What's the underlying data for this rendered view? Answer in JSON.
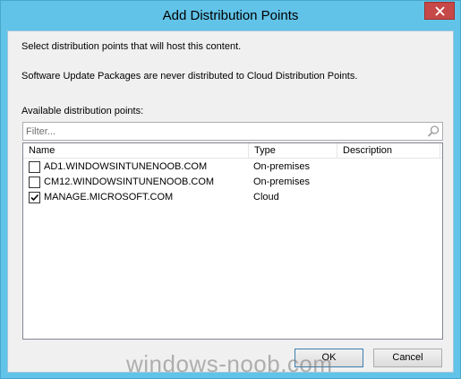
{
  "window": {
    "title": "Add Distribution Points"
  },
  "body": {
    "instruction": "Select distribution points that will host this content.",
    "note": "Software Update Packages are never distributed to Cloud Distribution Points.",
    "available_label": "Available distribution points:"
  },
  "filter": {
    "placeholder": "Filter..."
  },
  "list": {
    "columns": [
      "Name",
      "Type",
      "Description"
    ],
    "rows": [
      {
        "name": "AD1.WINDOWSINTUNENOOB.COM",
        "type": "On-premises",
        "description": "",
        "checked": false
      },
      {
        "name": "CM12.WINDOWSINTUNENOOB.COM",
        "type": "On-premises",
        "description": "",
        "checked": false
      },
      {
        "name": "MANAGE.MICROSOFT.COM",
        "type": "Cloud",
        "description": "",
        "checked": true
      }
    ]
  },
  "buttons": {
    "ok": "OK",
    "cancel": "Cancel"
  },
  "watermark": "windows-noob.com",
  "icons": {
    "close": "close-icon",
    "search": "search-icon",
    "check": "checkmark-icon"
  },
  "colors": {
    "titlebar": "#62c3e8",
    "close": "#c74848",
    "client": "#f0f0f0"
  }
}
